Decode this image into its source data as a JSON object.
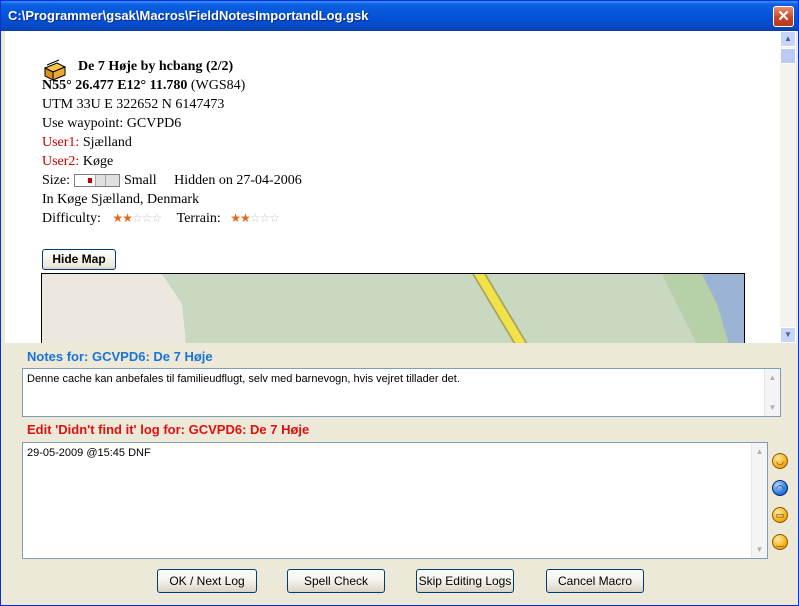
{
  "window": {
    "title": "C:\\Programmer\\gsak\\Macros\\FieldNotesImportandLog.gsk",
    "close_glyph": "✕"
  },
  "cache": {
    "name_line": "De 7 Høje by hcbang (2/2)",
    "coords_bold": "N55° 26.477  E12° 11.780",
    "coords_datum": " (WGS84)",
    "utm": "UTM  33U   E 322652  N 6147473",
    "waypoint": "Use waypoint: GCVPD6",
    "user1_label": "User1:",
    "user1_value": " Sjælland",
    "user2_label": "User2:",
    "user2_value": " Køge",
    "size_label": "Size:",
    "size_value": "Small",
    "hidden": "Hidden on 27-04-2006",
    "location": "In Køge Sjælland, Denmark",
    "difficulty_label": "Difficulty:",
    "difficulty_stars_on": "★★",
    "difficulty_stars_off": "☆☆☆",
    "difficulty_value": 2,
    "terrain_label": "Terrain:",
    "terrain_stars_on": "★★",
    "terrain_stars_off": "☆☆☆",
    "terrain_value": 2,
    "hide_map_label": "Hide Map"
  },
  "notes": {
    "heading": "Notes for: GCVPD6: De 7 Høje",
    "text": "Denne cache kan anbefales til familieudflugt, selv med barnevogn, hvis vejret tillader det."
  },
  "log": {
    "heading": "Edit 'Didn't find it' log for: GCVPD6: De 7 Høje",
    "text": "29-05-2009 @15:45 DNF"
  },
  "smileys": [
    "smile-icon",
    "sad-icon",
    "big-grin-icon",
    "wink-icon"
  ],
  "buttons": {
    "ok": "OK / Next Log",
    "spell": "Spell Check",
    "skip": "Skip Editing Logs",
    "cancel": "Cancel Macro"
  },
  "colors": {
    "notes_heading": "#1a73d9",
    "log_heading": "#e01010",
    "user_label": "#cc0000",
    "star_on": "#e06a1c",
    "map_land": "#ece8df",
    "map_green": "#c9d8c0",
    "map_road": "#f2e24a",
    "map_water": "#9cb4d4"
  }
}
